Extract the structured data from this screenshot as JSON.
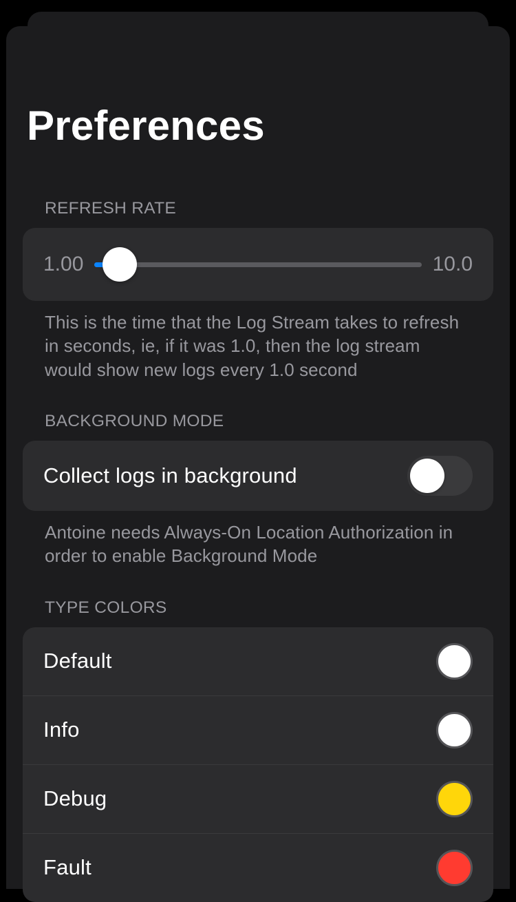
{
  "title": "Preferences",
  "refresh_rate": {
    "header": "REFRESH RATE",
    "min_label": "1.00",
    "max_label": "10.0",
    "min": 1.0,
    "max": 10.0,
    "value": 1.0,
    "footer": "This is the time that the Log Stream takes to refresh in seconds, ie, if it was 1.0, then the log stream would show new logs every 1.0 second"
  },
  "background_mode": {
    "header": "BACKGROUND MODE",
    "label": "Collect logs in background",
    "enabled": false,
    "footer": "Antoine needs Always-On Location Authorization in order to enable Background Mode"
  },
  "type_colors": {
    "header": "TYPE COLORS",
    "items": [
      {
        "label": "Default",
        "color": "#ffffff"
      },
      {
        "label": "Info",
        "color": "#ffffff"
      },
      {
        "label": "Debug",
        "color": "#ffd60a"
      },
      {
        "label": "Fault",
        "color": "#ff3b30"
      }
    ]
  }
}
